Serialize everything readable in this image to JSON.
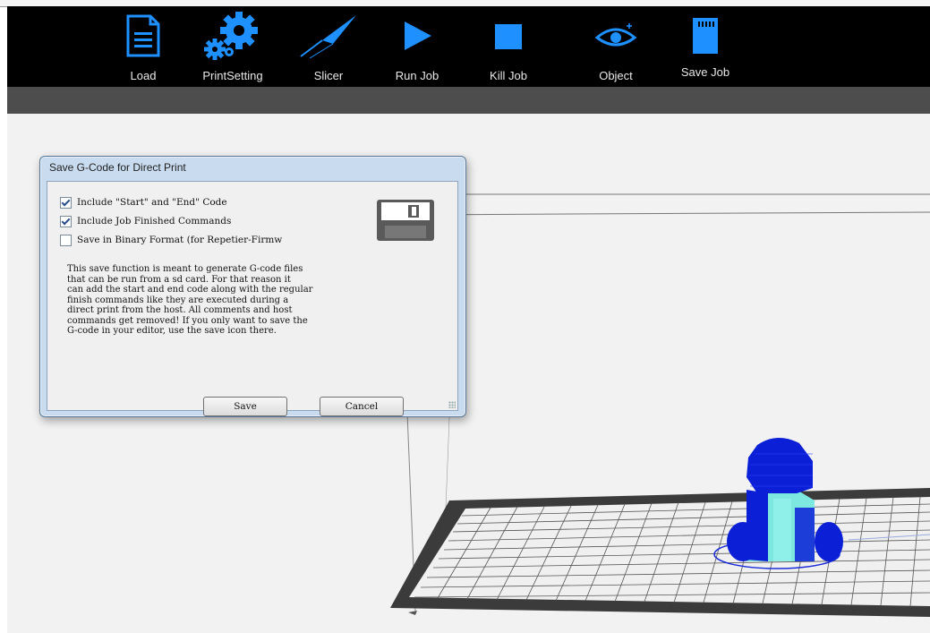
{
  "toolbar": {
    "items": [
      {
        "label": "Load",
        "icon": "document-icon"
      },
      {
        "label": "PrintSetting",
        "icon": "gears-icon"
      },
      {
        "label": "Slicer",
        "icon": "knife-icon"
      },
      {
        "label": "Run Job",
        "icon": "play-icon"
      },
      {
        "label": "Kill Job",
        "icon": "stop-icon"
      },
      {
        "label": "Object",
        "icon": "eye-icon"
      },
      {
        "label": "Save Job",
        "icon": "sd-card-icon"
      }
    ],
    "icon_color": "#1e90ff"
  },
  "dialog": {
    "title": "Save G-Code for Direct Print",
    "options": [
      {
        "label": "Include \"Start\" and \"End\" Code",
        "checked": true
      },
      {
        "label": "Include Job Finished Commands",
        "checked": true
      },
      {
        "label": "Save in Binary Format (for Repetier-Firmw",
        "checked": false
      }
    ],
    "description": "This save function is meant to generate G-code files\nthat can be run from a sd card. For that reason it\ncan add the start and end code along with the regular\nfinish commands like they are executed during a\ndirect print from the host. All comments and host\ncommands get removed! If you only want to save the\nG-code in your editor, use the save icon there.",
    "save_label": "Save",
    "cancel_label": "Cancel"
  },
  "colors": {
    "toolbar_bg": "#000000",
    "model_blue": "#0b1fd6",
    "model_cyan": "#7de8e0",
    "bed_border": "#3a3a3a"
  }
}
